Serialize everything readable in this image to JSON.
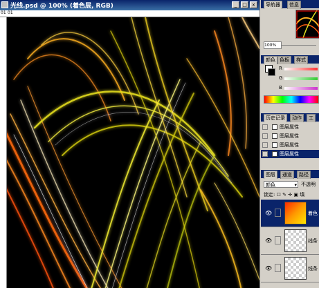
{
  "document": {
    "title": "光线.psd @ 100% (着色层, RGB)",
    "ruler_tick_labels": [
      "01",
      "01"
    ],
    "window_buttons": [
      "_",
      "□",
      "x"
    ]
  },
  "navigator": {
    "tabs": [
      "导航器",
      "信息"
    ],
    "zoom": "100%"
  },
  "color_panel": {
    "tabs": [
      "颜色",
      "色板",
      "样式"
    ],
    "channels": [
      {
        "label": "R",
        "color": "#ff3333"
      },
      {
        "label": "G",
        "color": "#33cc33"
      },
      {
        "label": "B",
        "color": "#cc33cc"
      }
    ]
  },
  "history_panel": {
    "tabs": [
      "历史记录",
      "动作",
      "工"
    ],
    "items": [
      {
        "label": "图层属性",
        "selected": false
      },
      {
        "label": "图层属性",
        "selected": false
      },
      {
        "label": "图层属性",
        "selected": false
      },
      {
        "label": "图层属性",
        "selected": true
      }
    ]
  },
  "layers_panel": {
    "tabs": [
      "图层",
      "通道",
      "路径"
    ],
    "blend_mode": "颜色",
    "opacity_label": "不透明",
    "lock_label": "锁定:",
    "lock_fill_label": "填",
    "layers": [
      {
        "name": "着色",
        "selected": true,
        "thumb": "gradient"
      },
      {
        "name": "线条",
        "selected": false,
        "thumb": "transparent"
      },
      {
        "name": "线条",
        "selected": false,
        "thumb": "transparent"
      }
    ]
  },
  "colors": {
    "title_bar": "#0a246a",
    "selection": "#0a246a",
    "canvas_bg": "#000000"
  }
}
